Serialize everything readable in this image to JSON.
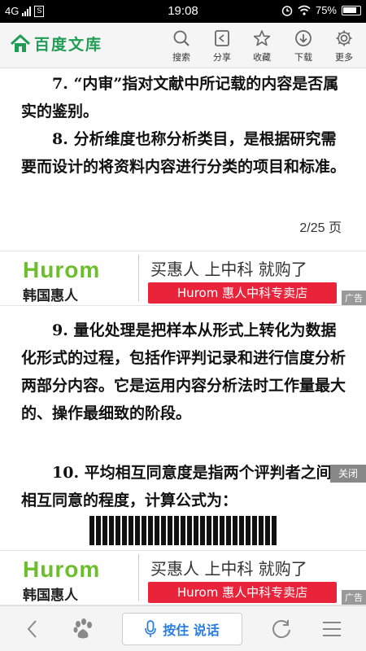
{
  "status": {
    "network": "4G",
    "sim_label": "S",
    "time": "19:08",
    "battery": "75%"
  },
  "header": {
    "app_name": "百度文库",
    "tools": [
      {
        "label": "搜索",
        "icon": "search-icon"
      },
      {
        "label": "分享",
        "icon": "share-icon"
      },
      {
        "label": "收藏",
        "icon": "star-icon"
      },
      {
        "label": "下载",
        "icon": "download-icon"
      },
      {
        "label": "更多",
        "icon": "gear-icon"
      }
    ]
  },
  "document": {
    "p7": "7. “内审”指对文献中所记载的内容是否属实的鉴别。",
    "p8": "8. 分析维度也称分析类目，是根据研究需要而设计的将资料内容进行分类的项目和标准。",
    "page_number": "2/25 页",
    "p9": "9. 量化处理是把样本从形式上转化为数据化形式的过程，包括作评判记录和进行信度分析两部分内容。它是运用内容分析法时工作量最大的、操作最细致的阶段。",
    "p10": "10. 平均相互同意度是指两个评判者之间相互同意的程度，计算公式为："
  },
  "ads": [
    {
      "logo": "Hurom",
      "brand_cn": "韩国惠人",
      "slogan": "买惠人 上中科 就购了",
      "cta": "Hurom 惠人中科专卖店",
      "tag": "广告"
    },
    {
      "logo": "Hurom",
      "brand_cn": "韩国惠人",
      "slogan": "买惠人 上中科 就购了",
      "cta": "Hurom 惠人中科专卖店",
      "tag": "广告"
    }
  ],
  "close_ad_label": "关闭",
  "bottom": {
    "voice_label": "按住 说话"
  },
  "colors": {
    "brand_green": "#1f9d55",
    "ad_red": "#e8233a",
    "voice_blue": "#2a7de1"
  }
}
